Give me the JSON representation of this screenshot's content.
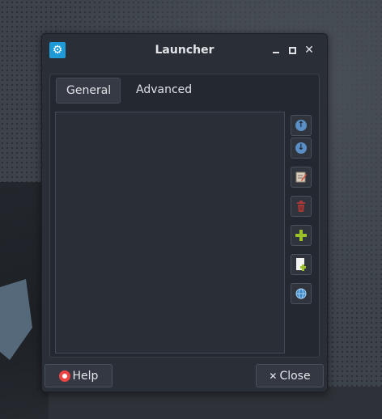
{
  "window": {
    "title": "Launcher",
    "controls": {
      "close": "✕"
    }
  },
  "tabs": [
    {
      "label": "General",
      "active": true
    },
    {
      "label": "Advanced",
      "active": false
    }
  ],
  "sidebar_buttons": [
    "move-up",
    "move-down",
    "edit",
    "delete",
    "add",
    "add-new-item",
    "web"
  ],
  "footer": {
    "help_label": "Help",
    "close_label": "Close",
    "close_glyph": "✕"
  },
  "colors": {
    "accent": "#1e9bd7",
    "arrow_blue": "#5a8fc6",
    "delete_red": "#a33a3a",
    "add_green": "#9bc02a"
  }
}
